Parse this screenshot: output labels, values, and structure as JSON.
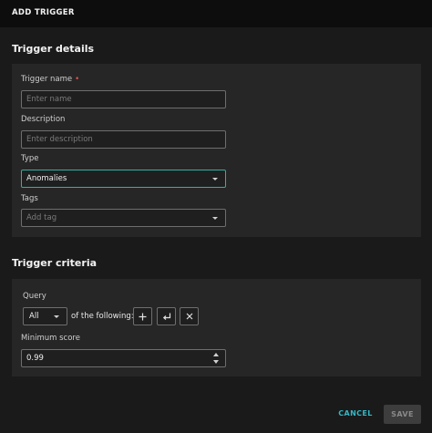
{
  "header": {
    "title": "ADD TRIGGER"
  },
  "trigger_details": {
    "title": "Trigger details",
    "name": {
      "label": "Trigger name",
      "required_mark": "•",
      "placeholder": "Enter name",
      "value": ""
    },
    "description": {
      "label": "Description",
      "placeholder": "Enter description",
      "value": ""
    },
    "type": {
      "label": "Type",
      "value": "Anomalies"
    },
    "tags": {
      "label": "Tags",
      "placeholder": "Add tag"
    }
  },
  "trigger_criteria": {
    "title": "Trigger criteria",
    "query": {
      "label": "Query",
      "operator": "All",
      "suffix": "of the following:",
      "add_icon": "plus-icon",
      "nest_icon": "return-arrow-icon",
      "remove_icon": "close-icon"
    },
    "minimum_score": {
      "label": "Minimum score",
      "value": "0.99"
    }
  },
  "footer": {
    "cancel_label": "CANCEL",
    "save_label": "SAVE"
  },
  "colors": {
    "accent": "#2fb1a4",
    "link": "#36b6c5",
    "required": "#e05252"
  }
}
